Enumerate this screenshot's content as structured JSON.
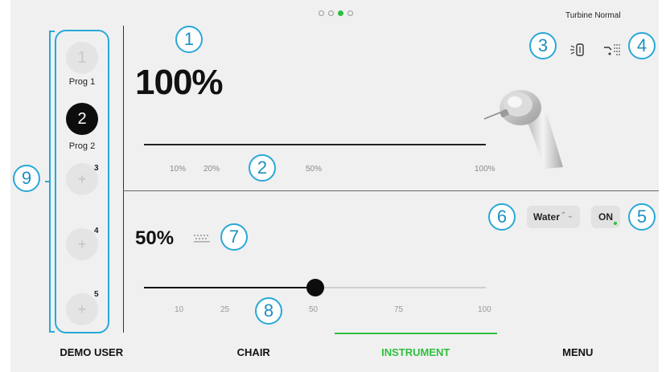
{
  "status": {
    "mode": "Turbine Normal",
    "page_dots": 4,
    "active_dot": 2
  },
  "programs": [
    {
      "number": "1",
      "label": "Prog 1",
      "state": "inactive"
    },
    {
      "number": "2",
      "label": "Prog 2",
      "state": "active"
    },
    {
      "number": "3",
      "label": "+",
      "state": "empty"
    },
    {
      "number": "4",
      "label": "+",
      "state": "empty"
    },
    {
      "number": "5",
      "label": "+",
      "state": "empty"
    }
  ],
  "speed": {
    "value": "100%",
    "ticks": [
      "10%",
      "20%",
      "50%",
      "100%"
    ]
  },
  "water": {
    "value": "50%",
    "level": 0.5,
    "ticks": [
      "10",
      "25",
      "50",
      "75",
      "100"
    ],
    "select_label": "Water",
    "select_chevron": "⌃⌄",
    "toggle_label": "ON"
  },
  "callouts": [
    "1",
    "2",
    "3",
    "4",
    "5",
    "6",
    "7",
    "8",
    "9"
  ],
  "icons": {
    "icon3": "light-icon",
    "icon4": "spray-icon",
    "water_icon": "water-flow-icon"
  },
  "nav": [
    {
      "label": "DEMO USER",
      "active": false
    },
    {
      "label": "CHAIR",
      "active": false
    },
    {
      "label": "INSTRUMENT",
      "active": true
    },
    {
      "label": "MENU",
      "active": false
    }
  ],
  "colors": {
    "accent": "#2fbf3f",
    "callout": "#29a8d8"
  }
}
